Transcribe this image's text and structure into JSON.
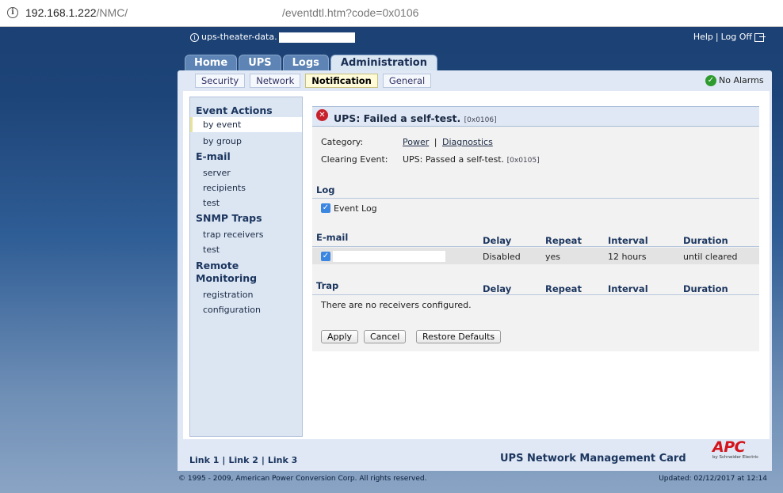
{
  "browser": {
    "host": "192.168.1.222",
    "path": "/NMC/",
    "url_tail": "/eventdtl.htm?code=0x0106"
  },
  "header": {
    "device_name": "ups-theater-data.",
    "help_label": "Help",
    "logoff_label": "Log Off"
  },
  "main_tabs": [
    "Home",
    "UPS",
    "Logs",
    "Administration"
  ],
  "sub_tabs": [
    "Security",
    "Network",
    "Notification",
    "General"
  ],
  "status": {
    "alarms": "No Alarms"
  },
  "sidebar": {
    "sections": [
      {
        "title": "Event Actions",
        "items": [
          "by event",
          "by group"
        ]
      },
      {
        "title": "E-mail",
        "items": [
          "server",
          "recipients",
          "test"
        ]
      },
      {
        "title": "SNMP Traps",
        "items": [
          "trap receivers",
          "test"
        ]
      },
      {
        "title": "Remote Monitoring",
        "items": [
          "registration",
          "configuration"
        ]
      }
    ]
  },
  "event": {
    "title": "UPS: Failed a self-test.",
    "code": "[0x0106]",
    "category_label": "Category:",
    "category_links": [
      "Power",
      "Diagnostics"
    ],
    "clearing_label": "Clearing Event:",
    "clearing_value": "UPS: Passed a self-test.",
    "clearing_code": "[0x0105]"
  },
  "log": {
    "heading": "Log",
    "event_log_label": "Event Log"
  },
  "email": {
    "heading": "E-mail",
    "columns": [
      "Delay",
      "Repeat",
      "Interval",
      "Duration"
    ],
    "row": {
      "delay": "Disabled",
      "repeat": "yes",
      "interval": "12 hours",
      "duration": "until cleared"
    }
  },
  "trap": {
    "heading": "Trap",
    "columns": [
      "Delay",
      "Repeat",
      "Interval",
      "Duration"
    ],
    "empty_message": "There are no receivers configured."
  },
  "buttons": {
    "apply": "Apply",
    "cancel": "Cancel",
    "restore": "Restore Defaults"
  },
  "footer": {
    "links": [
      "Link 1",
      "Link 2",
      "Link 3"
    ],
    "product": "UPS Network Management Card",
    "logo_text": "APC",
    "logo_sub": "by Schneider Electric",
    "copyright": "© 1995 - 2009, American Power Conversion Corp. All rights reserved.",
    "updated": "Updated: 02/12/2017 at 12:14"
  }
}
